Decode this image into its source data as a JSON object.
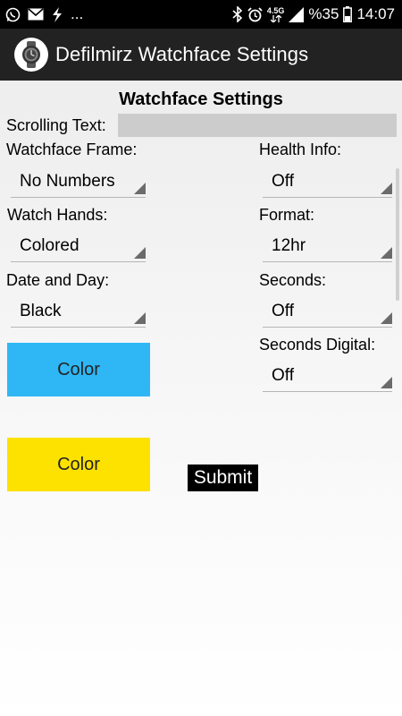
{
  "status_bar": {
    "left_icons": [
      "whatsapp-icon",
      "mail-icon",
      "flash-icon"
    ],
    "more": "...",
    "network": "4.5G",
    "battery": "%35",
    "time": "14:07"
  },
  "app_bar": {
    "title": "Defilmirz Watchface Settings",
    "logo_icon": "watch-icon"
  },
  "page": {
    "title": "Watchface Settings",
    "scrolling_text_label": "Scrolling Text:",
    "scrolling_text_value": ""
  },
  "left_column": {
    "frame_label": "Watchface Frame:",
    "frame_value": "No Numbers",
    "hands_label": "Watch Hands:",
    "hands_value": "Colored",
    "date_label": "Date and Day:",
    "date_value": "Black"
  },
  "right_column": {
    "health_label": "Health Info:",
    "health_value": "Off",
    "format_label": "Format:",
    "format_value": "12hr",
    "seconds_label": "Seconds:",
    "seconds_value": "Off",
    "seconds_digital_label": "Seconds Digital:",
    "seconds_digital_value": "Off"
  },
  "buttons": {
    "color_1_label": "Color",
    "color_1_bg": "#2fb7f5",
    "color_2_label": "Color",
    "color_2_bg": "#fde200",
    "submit_label": "Submit"
  }
}
